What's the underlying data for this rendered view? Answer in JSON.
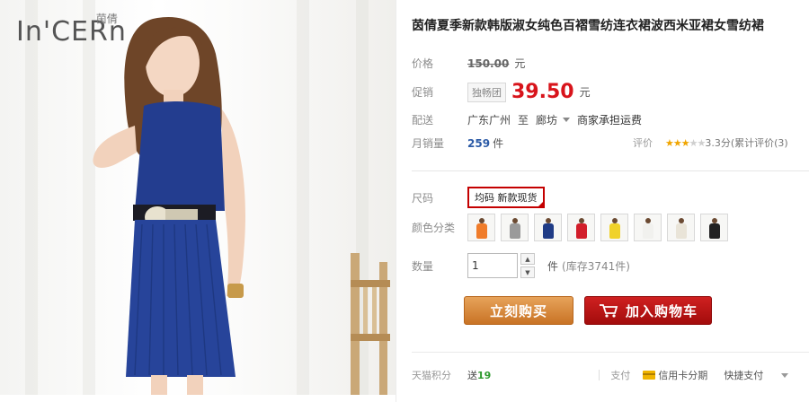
{
  "brand": {
    "wordmark": "In'CERn",
    "chinese": "茵倩"
  },
  "product": {
    "title": "茵倩夏季新款韩版淑女纯色百褶雪纺连衣裙波西米亚裙女雪纺裙"
  },
  "price": {
    "label": "价格",
    "original": "150.00",
    "unit": "元"
  },
  "promo": {
    "label": "促销",
    "tag": "独畅团",
    "price": "39.50",
    "unit": "元"
  },
  "shipping": {
    "label": "配送",
    "from": "广东广州",
    "to_word": "至",
    "to": "廊坊",
    "fee": "商家承担运费"
  },
  "sales": {
    "label": "月销量",
    "count": "259",
    "unit": "件"
  },
  "rating": {
    "label": "评价",
    "stars_on": "★★★",
    "stars_off": "★★",
    "score_text": "3.3分(累计评价(3)",
    "score": 3.3
  },
  "size": {
    "label": "尺码",
    "selected": "均码 新款现货"
  },
  "colors": {
    "label": "颜色分类",
    "swatches": [
      {
        "name": "orange",
        "color": "#f07c2a"
      },
      {
        "name": "grey",
        "color": "#9a9a9a"
      },
      {
        "name": "navy",
        "color": "#203c86"
      },
      {
        "name": "red",
        "color": "#d21e2a"
      },
      {
        "name": "yellow",
        "color": "#f0d22a"
      },
      {
        "name": "white",
        "color": "#f1f1ee"
      },
      {
        "name": "cream",
        "color": "#e9e4d8"
      },
      {
        "name": "black",
        "color": "#222222"
      }
    ]
  },
  "quantity": {
    "label": "数量",
    "value": "1",
    "unit": "件",
    "stock": "(库存3741件)"
  },
  "buttons": {
    "buy_now": "立刻购买",
    "add_cart": "加入购物车"
  },
  "footer": {
    "points_label": "天猫积分",
    "points_prefix": "送",
    "points_value": "19",
    "pay_label": "支付",
    "credit": "信用卡分期",
    "quick": "快捷支付"
  },
  "colors_theme": {
    "price_red": "#d21e2a",
    "buy_orange": "#d88a3c",
    "cart_red": "#b81515",
    "link_blue": "#2b5aa6"
  }
}
